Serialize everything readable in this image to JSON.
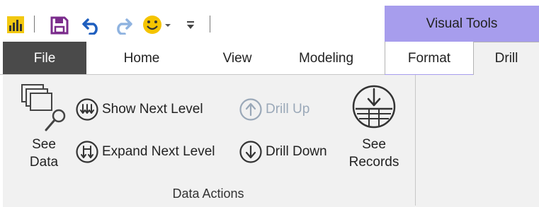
{
  "quick_access": {
    "items": [
      {
        "name": "app-logo-icon"
      },
      {
        "name": "save-icon"
      },
      {
        "name": "undo-icon"
      },
      {
        "name": "redo-icon"
      },
      {
        "name": "smiley-feedback-icon"
      },
      {
        "name": "customize-qat-icon"
      }
    ]
  },
  "context_header": {
    "label": "Visual Tools",
    "color": "#a79ded"
  },
  "tabs": [
    {
      "label": "File",
      "active": false
    },
    {
      "label": "Home",
      "active": false
    },
    {
      "label": "View",
      "active": false
    },
    {
      "label": "Modeling",
      "active": false
    },
    {
      "label": "Format",
      "active": false
    },
    {
      "label": "Drill",
      "active": true
    }
  ],
  "ribbon": {
    "group_label": "Data Actions",
    "see_data": {
      "line1": "See",
      "line2": "Data",
      "icon": "see-data-icon"
    },
    "show_next_level": {
      "label": "Show Next Level",
      "icon": "show-next-level-icon"
    },
    "expand_next_level": {
      "label": "Expand Next Level",
      "icon": "expand-next-level-icon"
    },
    "drill_up": {
      "label": "Drill Up",
      "icon": "drill-up-icon",
      "enabled": false
    },
    "drill_down": {
      "label": "Drill Down",
      "icon": "drill-down-icon",
      "enabled": true
    },
    "see_records": {
      "line1": "See",
      "line2": "Records",
      "icon": "see-records-icon"
    }
  },
  "colors": {
    "file_tab_bg": "#4a4a4a",
    "ribbon_bg": "#f1f1f1",
    "save_icon": "#7b2c8c",
    "undo_redo": "#1f5fbf",
    "disabled_text": "#9aa8b8"
  }
}
